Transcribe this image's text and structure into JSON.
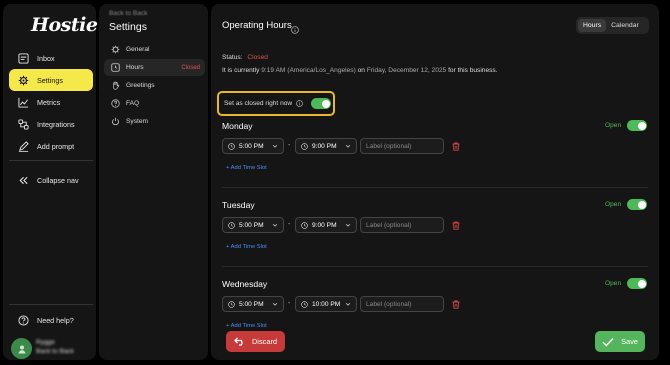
{
  "app": {
    "logo_text": "Hostie"
  },
  "sidebar": {
    "items": [
      {
        "label": "Inbox",
        "icon": "inbox-icon"
      },
      {
        "label": "Settings",
        "icon": "gear-icon",
        "active": true
      },
      {
        "label": "Metrics",
        "icon": "chart-icon"
      },
      {
        "label": "Integrations",
        "icon": "integrations-icon"
      },
      {
        "label": "Add prompt",
        "icon": "pencil-icon"
      }
    ],
    "collapse_label": "Collapse nav",
    "help_label": "Need help?",
    "user": {
      "name": "Rygge",
      "subtitle": "Back to Back"
    }
  },
  "subnav": {
    "back_label": "Back to Back",
    "title": "Settings",
    "items": [
      {
        "label": "General",
        "icon": "gear-icon"
      },
      {
        "label": "Hours",
        "icon": "clock-icon",
        "badge": "Closed",
        "active": true
      },
      {
        "label": "Greetings",
        "icon": "hand-icon"
      },
      {
        "label": "FAQ",
        "icon": "help-circle-icon"
      },
      {
        "label": "System",
        "icon": "power-icon"
      }
    ]
  },
  "main": {
    "title": "Operating Hours",
    "view_tabs": [
      {
        "label": "Hours",
        "active": true
      },
      {
        "label": "Calendar",
        "active": false
      }
    ],
    "status_label": "Status:",
    "status_value": "Closed",
    "currently_prefix": "It is currently",
    "current_time": "9:19 AM (America/Los_Angeles)",
    "on_word": "on",
    "current_date": "Friday, December 12, 2025",
    "currently_suffix": "for this business.",
    "closed_now_label": "Set as closed right now",
    "days": [
      {
        "name": "Monday",
        "status": "Open",
        "start": "5:00 PM",
        "end": "9:00 PM",
        "label_placeholder": "Label (optional)"
      },
      {
        "name": "Tuesday",
        "status": "Open",
        "start": "5:00 PM",
        "end": "9:00 PM",
        "label_placeholder": "Label (optional)"
      },
      {
        "name": "Wednesday",
        "status": "Open",
        "start": "5:00 PM",
        "end": "10:00 PM",
        "label_placeholder": "Label (optional)"
      }
    ],
    "add_slot_label": "+ Add Time Slot",
    "time_separator": "-"
  },
  "footer": {
    "discard_label": "Discard",
    "save_label": "Save"
  },
  "colors": {
    "accent": "#f5e94a",
    "open": "#4cbb57",
    "closed": "#e05252",
    "discard": "#c73a3a",
    "save": "#55b55d",
    "highlight_border": "#e7b829"
  }
}
